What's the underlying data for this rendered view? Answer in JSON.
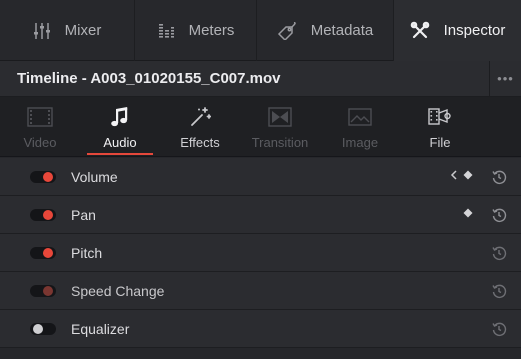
{
  "top_tabs": [
    {
      "label": "Mixer",
      "icon": "mixer-icon"
    },
    {
      "label": "Meters",
      "icon": "meters-icon"
    },
    {
      "label": "Metadata",
      "icon": "metadata-icon"
    },
    {
      "label": "Inspector",
      "icon": "inspector-icon",
      "active": true
    }
  ],
  "title_bar": {
    "title": "Timeline - A003_01020155_C007.mov",
    "more_label": "•••"
  },
  "sub_tabs": [
    {
      "label": "Video",
      "icon": "video-icon",
      "state": "disabled"
    },
    {
      "label": "Audio",
      "icon": "music-note-icon",
      "state": "active"
    },
    {
      "label": "Effects",
      "icon": "magic-wand-icon",
      "state": "enabled"
    },
    {
      "label": "Transition",
      "icon": "transition-icon",
      "state": "disabled"
    },
    {
      "label": "Image",
      "icon": "image-icon",
      "state": "disabled"
    },
    {
      "label": "File",
      "icon": "file-icon",
      "state": "enabled"
    }
  ],
  "rows": [
    {
      "label": "Volume",
      "toggle": "on",
      "keyframe_nav": true
    },
    {
      "label": "Pan",
      "toggle": "on",
      "keyframe": true
    },
    {
      "label": "Pitch",
      "toggle": "on"
    },
    {
      "label": "Speed Change",
      "toggle": "dim"
    },
    {
      "label": "Equalizer",
      "toggle": "off"
    }
  ],
  "colors": {
    "accent": "#e5483b",
    "panel": "#2b2c30",
    "background": "#1f2023"
  }
}
